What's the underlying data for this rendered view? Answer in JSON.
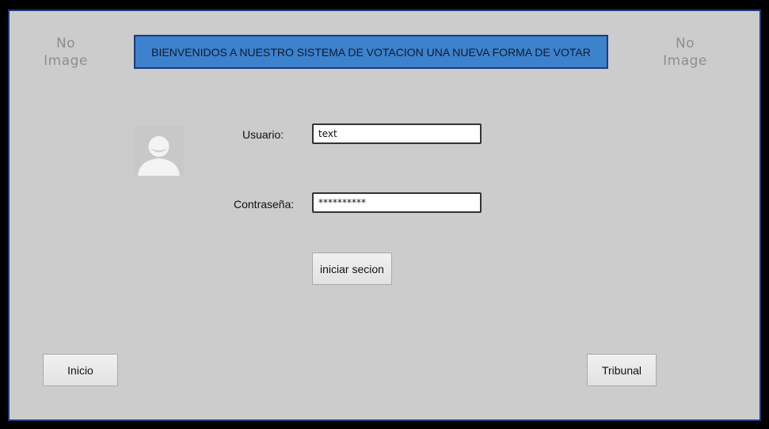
{
  "header": {
    "left_placeholder": {
      "line1": "No",
      "line2": "Image",
      "icon": "image-placeholder-icon"
    },
    "right_placeholder": {
      "line1": "No",
      "line2": "Image",
      "icon": "image-placeholder-icon"
    },
    "banner_text": "BIENVENIDOS A NUESTRO SISTEMA DE VOTACION UNA NUEVA FORMA DE VOTAR",
    "banner_color": "#3d82cd"
  },
  "login": {
    "avatar_icon": "user-avatar-icon",
    "username_label": "Usuario:",
    "username_value": "text",
    "password_label": "Contraseña:",
    "password_value": "**********",
    "submit_label": "iniciar secion"
  },
  "footer": {
    "home_label": "Inicio",
    "tribunal_label": "Tribunal"
  },
  "colors": {
    "background": "#cccccc",
    "frame_border": "#1f3a7a"
  }
}
